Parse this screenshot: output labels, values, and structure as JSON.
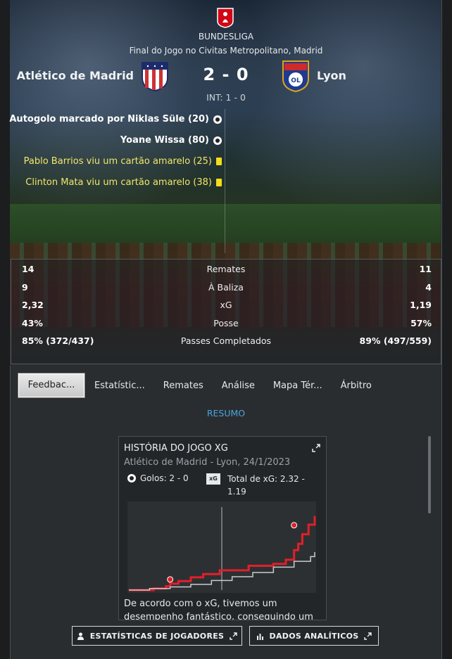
{
  "header": {
    "competition": "BUNDESLIGA",
    "venue": "Final do Jogo no Civitas Metropolitano, Madrid",
    "home_team": "Atlético de Madrid",
    "away_team": "Lyon",
    "score": "2 - 0",
    "half_time": "INT: 1 - 0"
  },
  "events": [
    {
      "text": "Autogolo marcado por Niklas Süle (20)",
      "type": "own-goal",
      "style": "white"
    },
    {
      "text": "Yoane Wissa (80)",
      "type": "goal",
      "style": "white"
    },
    {
      "text": "Pablo Barrios viu um cartão amarelo (25)",
      "type": "yellow-card",
      "style": "yellow"
    },
    {
      "text": "Clinton Mata viu um cartão amarelo (38)",
      "type": "yellow-card",
      "style": "yellow"
    }
  ],
  "stats": [
    {
      "home": "14",
      "label": "Remates",
      "away": "11"
    },
    {
      "home": "9",
      "label": "À Baliza",
      "away": "4"
    },
    {
      "home": "2,32",
      "label": "xG",
      "away": "1,19"
    },
    {
      "home": "43%",
      "label": "Posse",
      "away": "57%"
    },
    {
      "home": "85% (372/437)",
      "label": "Passes Completados",
      "away": "89% (497/559)"
    }
  ],
  "tabs": [
    "Feedbac...",
    "Estatístic...",
    "Remates",
    "Análise",
    "Mapa Tér...",
    "Árbitro"
  ],
  "active_tab": 0,
  "section_label": "RESUMO",
  "xg_card": {
    "title": "HISTÓRIA DO JOGO XG",
    "subtitle": "Atlético de Madrid - Lyon, 24/1/2023",
    "goals": "Golos: 2 - 0",
    "xg_total": "Total de xG: 2.32 - 1.19",
    "xg_icon_label": "xG",
    "text": "De acordo com o xG, tivemos um desempenho fantástico, conseguindo um"
  },
  "chart_data": {
    "type": "line",
    "series": [
      {
        "color": "#e0202a",
        "points": [
          [
            0,
            0.0
          ],
          [
            12,
            0.05
          ],
          [
            18,
            0.12
          ],
          [
            20,
            0.2
          ],
          [
            24,
            0.28
          ],
          [
            30,
            0.4
          ],
          [
            36,
            0.5
          ],
          [
            44,
            0.62
          ],
          [
            58,
            0.76
          ],
          [
            70,
            0.82
          ],
          [
            76,
            0.95
          ],
          [
            80,
            1.25
          ],
          [
            82,
            1.45
          ],
          [
            84,
            1.75
          ],
          [
            87,
            2.05
          ],
          [
            90,
            2.32
          ]
        ]
      },
      {
        "color": "#c9ccce",
        "points": [
          [
            0,
            0.0
          ],
          [
            10,
            0.05
          ],
          [
            20,
            0.1
          ],
          [
            30,
            0.18
          ],
          [
            40,
            0.3
          ],
          [
            50,
            0.42
          ],
          [
            60,
            0.55
          ],
          [
            70,
            0.72
          ],
          [
            80,
            0.9
          ],
          [
            88,
            1.05
          ],
          [
            90,
            1.19
          ]
        ]
      }
    ],
    "goal_markers": [
      {
        "minute": 20,
        "xg": 0.2
      },
      {
        "minute": 80,
        "xg": 1.9
      }
    ],
    "half_time_minute": 45,
    "xlim": [
      0,
      90
    ],
    "ylim": [
      0,
      2.6
    ]
  },
  "buttons": {
    "players": "ESTATÍSTICAS DE JOGADORES",
    "analytics": "DADOS ANALÍTICOS"
  },
  "colors": {
    "accent": "#4aa3dd",
    "card_yellow": "#f3dd1d",
    "home_line": "#e0202a"
  }
}
